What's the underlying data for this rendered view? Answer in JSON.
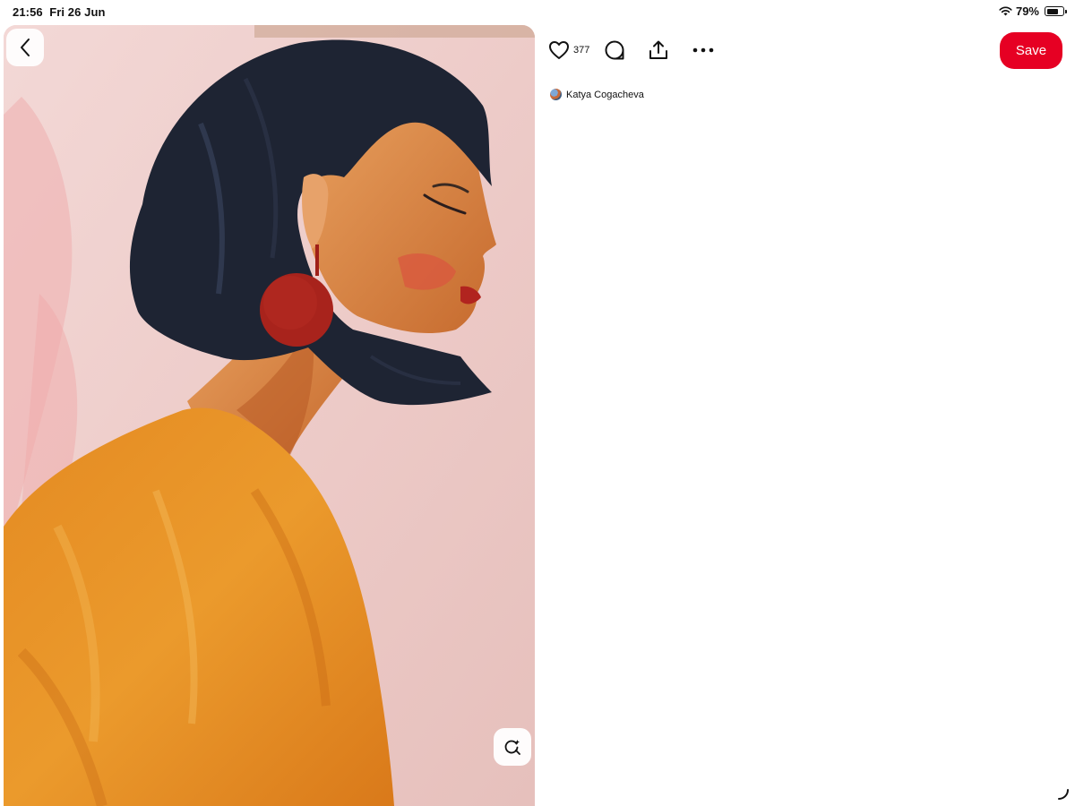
{
  "status_bar": {
    "time": "21:56",
    "date": "Fri 26 Jun",
    "battery_text": "79%",
    "battery_level": 0.79
  },
  "pin": {
    "image_description_icon": "painting-image",
    "back_icon": "chevron-left-icon",
    "visual_search_icon": "visual-search-icon"
  },
  "actions": {
    "like_icon": "heart-icon",
    "like_count": "377",
    "comment_icon": "comment-icon",
    "share_icon": "share-icon",
    "more_icon": "more-icon",
    "save_label": "Save"
  },
  "creator": {
    "name": "Katya Cogacheva"
  },
  "colors": {
    "save": "#e60023",
    "background": "#ffffff"
  }
}
